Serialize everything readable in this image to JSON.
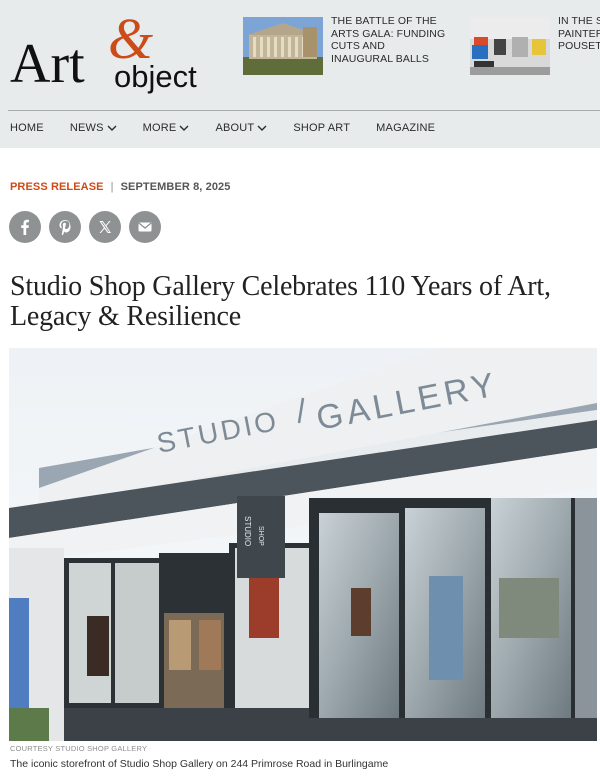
{
  "site": {
    "logo_word": "Art",
    "logo_amp": "&",
    "logo_word2": "object"
  },
  "teasers": [
    {
      "title_lines": [
        "THE BATTLE OF THE",
        "ARTS GALA: FUNDING",
        "CUTS AND",
        "INAUGURAL BALLS"
      ]
    },
    {
      "title_lines": [
        "IN THE S",
        "PAINTER",
        "POUSET"
      ]
    }
  ],
  "nav": {
    "items": [
      {
        "label": "HOME",
        "dropdown": false
      },
      {
        "label": "NEWS",
        "dropdown": true
      },
      {
        "label": "MORE",
        "dropdown": true
      },
      {
        "label": "ABOUT",
        "dropdown": true
      },
      {
        "label": "SHOP ART",
        "dropdown": false
      },
      {
        "label": "MAGAZINE",
        "dropdown": false
      }
    ]
  },
  "article": {
    "kind": "PRESS RELEASE",
    "separator": "|",
    "date": "SEPTEMBER 8, 2025",
    "headline": "Studio Shop Gallery Celebrates 110 Years of Art, Legacy & Resilience",
    "image_signage": {
      "left": "STUDIO",
      "right": "GALLERY",
      "sign_lines": [
        "STUDIO",
        "SHOP"
      ]
    },
    "credit": "COURTESY STUDIO SHOP GALLERY",
    "caption": "The iconic storefront of Studio Shop Gallery on 244 Primrose Road in Burlingame"
  },
  "share": [
    "facebook-icon",
    "pinterest-icon",
    "x-icon",
    "email-icon"
  ],
  "colors": {
    "header_bg": "#e8ebeb",
    "accent": "#cc4b17",
    "share_bg": "#8f9293"
  }
}
